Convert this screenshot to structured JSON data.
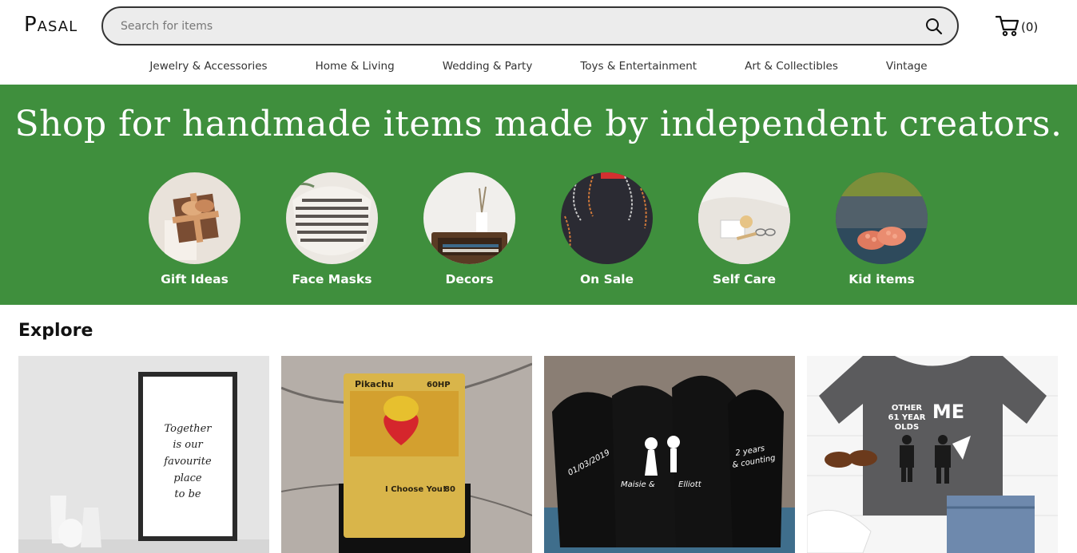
{
  "header": {
    "logo": "Pasal",
    "search_placeholder": "Search for items",
    "cart_count": "(0)"
  },
  "categories_nav": [
    "Jewelry & Accessories",
    "Home & Living",
    "Wedding & Party",
    "Toys & Entertainment",
    "Art & Collectibles",
    "Vintage"
  ],
  "hero": {
    "headline": "Shop for handmade items made by independent creators.",
    "background": "#3f8f3d",
    "categories": [
      {
        "label": "Gift Ideas"
      },
      {
        "label": "Face Masks"
      },
      {
        "label": "Decors"
      },
      {
        "label": "On Sale"
      },
      {
        "label": "Self Care"
      },
      {
        "label": "Kid items"
      }
    ]
  },
  "explore": {
    "title": "Explore",
    "items": [
      {
        "print_line1": "Together",
        "print_line2": "is our",
        "print_line3": "favourite",
        "print_line4": "place",
        "print_line5": "to be"
      },
      {
        "card_name": "Pikachu",
        "card_hp": "60HP",
        "card_move": "I Choose You!",
        "card_damage": "80"
      },
      {
        "sock_date": "01/03/2019",
        "sock_name1": "Maisie &",
        "sock_name2": "Elliott",
        "sock_years1": "2 years",
        "sock_years2": "& counting"
      },
      {
        "shirt_left_line1": "OTHER",
        "shirt_left_line2": "61 YEAR",
        "shirt_left_line3": "OLDS",
        "shirt_right": "ME"
      }
    ]
  }
}
